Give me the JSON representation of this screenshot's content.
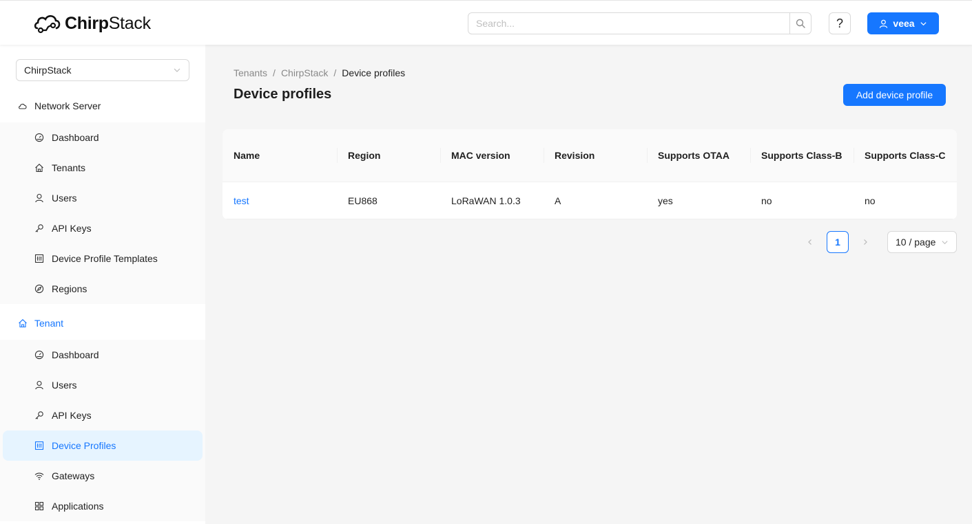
{
  "header": {
    "brand": {
      "bold": "Chirp",
      "light": "Stack"
    },
    "search_placeholder": "Search...",
    "help_label": "?",
    "user_label": "veea"
  },
  "sidebar": {
    "tenant_select": "ChirpStack",
    "network_server": {
      "title": "Network Server",
      "items": [
        {
          "label": "Dashboard",
          "icon": "dashboard-icon"
        },
        {
          "label": "Tenants",
          "icon": "home-icon"
        },
        {
          "label": "Users",
          "icon": "user-icon"
        },
        {
          "label": "API Keys",
          "icon": "key-icon"
        },
        {
          "label": "Device Profile Templates",
          "icon": "profile-icon"
        },
        {
          "label": "Regions",
          "icon": "compass-icon"
        }
      ]
    },
    "tenant": {
      "title": "Tenant",
      "items": [
        {
          "label": "Dashboard",
          "icon": "dashboard-icon"
        },
        {
          "label": "Users",
          "icon": "user-icon"
        },
        {
          "label": "API Keys",
          "icon": "key-icon"
        },
        {
          "label": "Device Profiles",
          "icon": "profile-icon",
          "selected": true
        },
        {
          "label": "Gateways",
          "icon": "wifi-icon"
        },
        {
          "label": "Applications",
          "icon": "appstore-icon"
        }
      ]
    }
  },
  "breadcrumb": {
    "items": [
      "Tenants",
      "ChirpStack",
      "Device profiles"
    ],
    "separator": "/"
  },
  "page": {
    "title": "Device profiles",
    "add_button": "Add device profile"
  },
  "table": {
    "columns": [
      "Name",
      "Region",
      "MAC version",
      "Revision",
      "Supports OTAA",
      "Supports Class-B",
      "Supports Class-C"
    ],
    "rows": [
      [
        "test",
        "EU868",
        "LoRaWAN 1.0.3",
        "A",
        "yes",
        "no",
        "no"
      ]
    ]
  },
  "pagination": {
    "prev": "<",
    "current": "1",
    "next": ">",
    "page_size": "10 / page"
  },
  "colors": {
    "primary": "#1677ff",
    "bg": "#f5f5f5",
    "selected_bg": "#e6f4ff"
  }
}
